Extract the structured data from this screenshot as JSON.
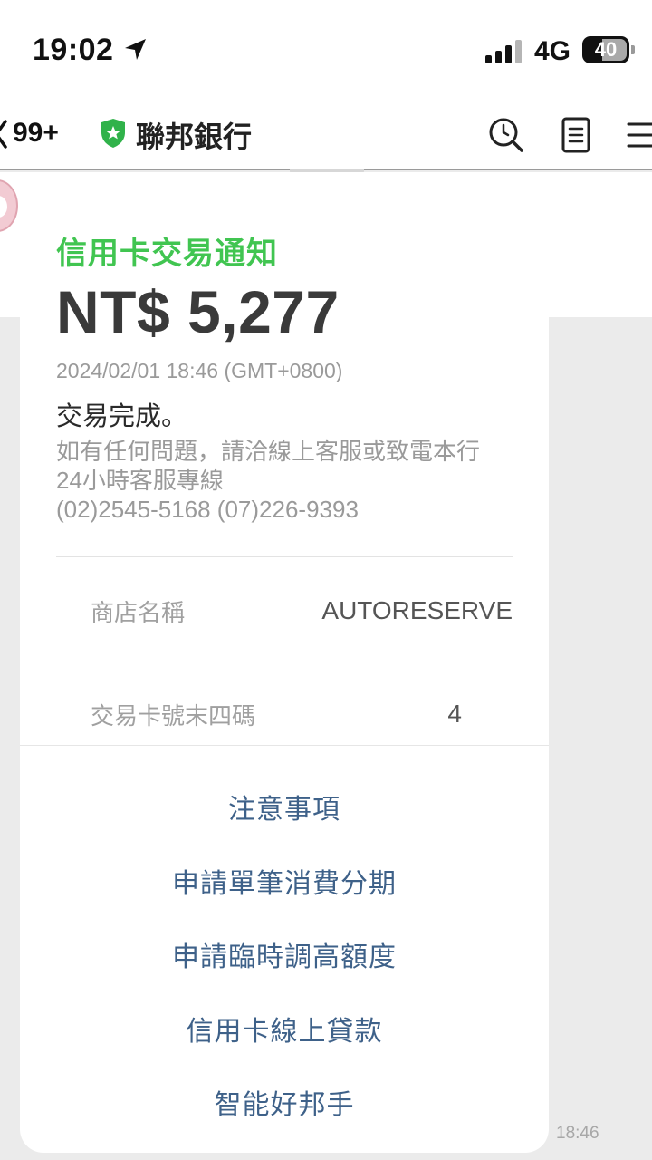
{
  "status_bar": {
    "time": "19:02",
    "network": "4G",
    "battery": "40"
  },
  "header": {
    "unread_count": "99+",
    "title": "聯邦銀行",
    "icons": [
      "back-chevron-icon",
      "verified-shield-icon",
      "search-icon",
      "notes-icon",
      "menu-icon"
    ]
  },
  "message": {
    "title": "信用卡交易通知",
    "amount": "NT$ 5,277",
    "timestamp": "2024/02/01 18:46 (GMT+0800)",
    "status": "交易完成。",
    "help_line1": "如有任何問題，請洽線上客服或致電本行",
    "help_line2": "24小時客服專線",
    "help_line3": "(02)2545-5168 (07)226-9393",
    "details": [
      {
        "label": "商店名稱",
        "value": "AUTORESERVE"
      },
      {
        "label": "交易卡號末四碼",
        "value": "4"
      }
    ],
    "actions": [
      "注意事項",
      "申請單筆消費分期",
      "申請臨時調高額度",
      "信用卡線上貸款",
      "智能好邦手"
    ],
    "sent_time": "18:46"
  },
  "colors": {
    "title_green": "#41c551",
    "link_blue": "#3e6189",
    "chat_background": "#ebebeb"
  }
}
